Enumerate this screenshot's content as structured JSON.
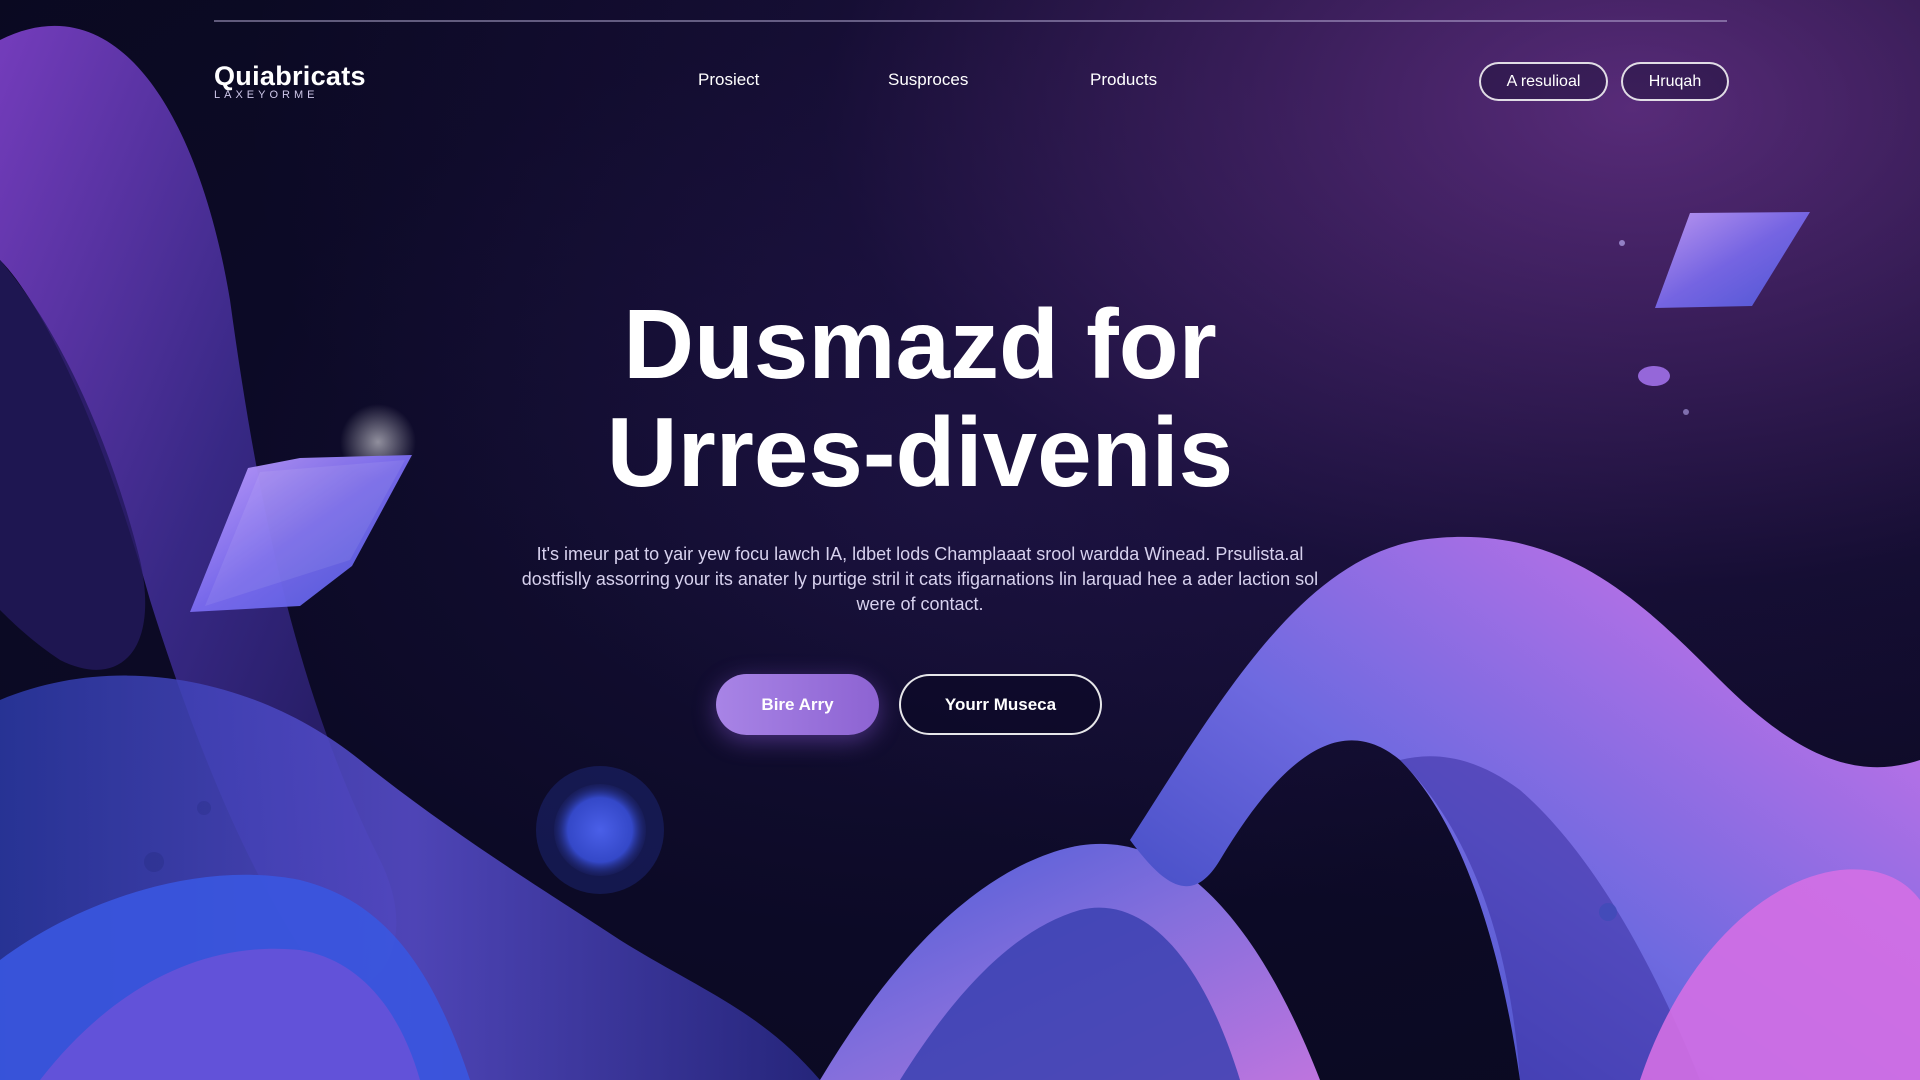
{
  "brand": {
    "name": "Quiabricats",
    "tagline": "LAXEYORME"
  },
  "nav": {
    "links": [
      "Prosiect",
      "Susproces",
      "Products"
    ],
    "buttons": [
      "A resulioal",
      "Hruqah"
    ]
  },
  "hero": {
    "title_line1": "Dusmazd for",
    "title_line2": "Urres-divenis",
    "subtitle": "It's imeur pat to yair yew focu lawch IA, ldbet lods Champlaaat srool wardda Winead. Prsulista.al dostfislly assorring your its anater ly purtige stril it cats ifigarnations lin larquad hee a ader laction sol were of contact."
  },
  "cta": {
    "primary_label": "Bire Arry",
    "secondary_label": "Yourr Museca"
  },
  "colors": {
    "background": "#0c0a26",
    "accent_purple": "#a884e6",
    "ribbon_blue": "#3f48c8",
    "ribbon_pink": "#d470e8"
  }
}
